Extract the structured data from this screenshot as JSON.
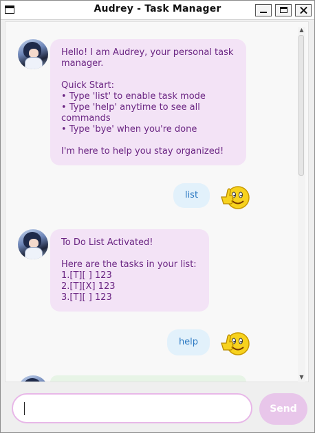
{
  "window": {
    "title": "Audrey - Task Manager"
  },
  "chat": {
    "messages": [
      {
        "sender": "bot",
        "text": "Hello! I am Audrey, your personal task\nmanager.\n\nQuick Start:\n• Type 'list' to enable task mode\n• Type 'help' anytime to see all\ncommands\n• Type 'bye' when you're done\n\nI'm here to help you stay organized!"
      },
      {
        "sender": "user",
        "text": "list"
      },
      {
        "sender": "bot",
        "text": "To Do List Activated!\n\nHere are the tasks in your list:\n1.[T][ ] 123\n2.[T][X] 123\n3.[T][ ] 123"
      },
      {
        "sender": "user",
        "text": "help"
      }
    ]
  },
  "input": {
    "value": "",
    "placeholder": ""
  },
  "send_button": {
    "label": "Send"
  },
  "colors": {
    "bot_bubble": "#f3e3f6",
    "bot_text": "#6b2683",
    "user_bubble": "#e2f1fb",
    "user_text": "#2a78c2",
    "send_button": "#e8c6ea",
    "next_bubble": "#e7f4e6"
  },
  "icons": {
    "bot_avatar": "anime-avatar-icon",
    "user_avatar": "thumbs-up-smiley-icon"
  }
}
